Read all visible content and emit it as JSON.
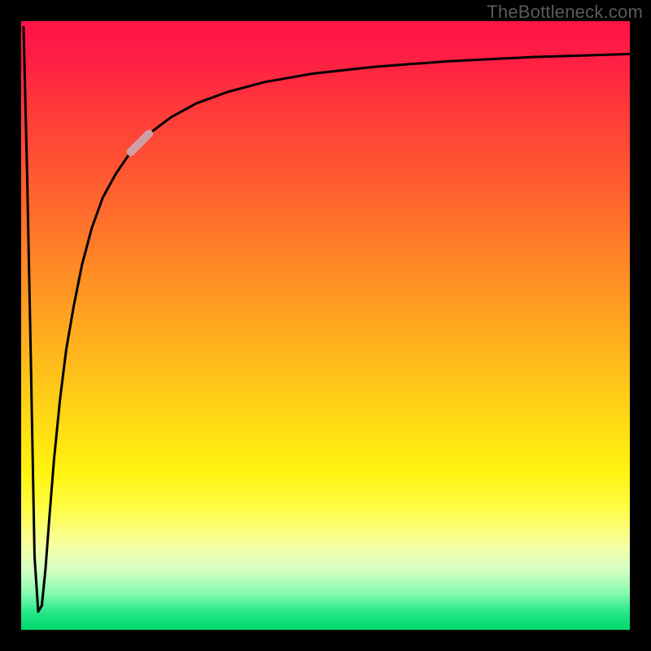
{
  "watermark": "TheBottleneck.com",
  "chart_data": {
    "type": "line",
    "title": "",
    "xlabel": "",
    "ylabel": "",
    "xlim": [
      0,
      100
    ],
    "ylim": [
      0,
      100
    ],
    "grid": false,
    "legend": false,
    "series": [
      {
        "name": "bottleneck-curve",
        "x": [
          0.4,
          1.0,
          1.6,
          2.2,
          2.8,
          3.4,
          4.0,
          4.6,
          5.4,
          6.4,
          7.4,
          8.6,
          10.0,
          11.6,
          13.4,
          15.6,
          18.0,
          21.0,
          24.6,
          28.8,
          34.0,
          40.0,
          48.0,
          58.0,
          70.0,
          84.0,
          100.0
        ],
        "y": [
          99.0,
          74.0,
          44.0,
          12.0,
          3.0,
          4.0,
          10.0,
          18.0,
          28.0,
          38.0,
          46.0,
          53.0,
          60.0,
          66.0,
          71.0,
          75.0,
          78.5,
          81.5,
          84.2,
          86.5,
          88.4,
          90.0,
          91.4,
          92.5,
          93.4,
          94.1,
          94.6
        ]
      }
    ],
    "highlight": {
      "series": "bottleneck-curve",
      "x_range": [
        17.0,
        24.0
      ],
      "color": "#cf9fa6",
      "width": 10
    },
    "annotations": []
  },
  "gradient_stops": [
    {
      "pos": 0,
      "color": "#ff1448"
    },
    {
      "pos": 6,
      "color": "#ff1e44"
    },
    {
      "pos": 14,
      "color": "#ff383a"
    },
    {
      "pos": 26,
      "color": "#ff5a30"
    },
    {
      "pos": 40,
      "color": "#ff8826"
    },
    {
      "pos": 54,
      "color": "#ffb41c"
    },
    {
      "pos": 66,
      "color": "#ffdb14"
    },
    {
      "pos": 74,
      "color": "#fff30e"
    },
    {
      "pos": 80,
      "color": "#fffc44"
    },
    {
      "pos": 86,
      "color": "#f7ffa0"
    },
    {
      "pos": 90,
      "color": "#d8ffc4"
    },
    {
      "pos": 94,
      "color": "#86fbb0"
    },
    {
      "pos": 97,
      "color": "#28e78a"
    },
    {
      "pos": 100,
      "color": "#00d86e"
    }
  ]
}
